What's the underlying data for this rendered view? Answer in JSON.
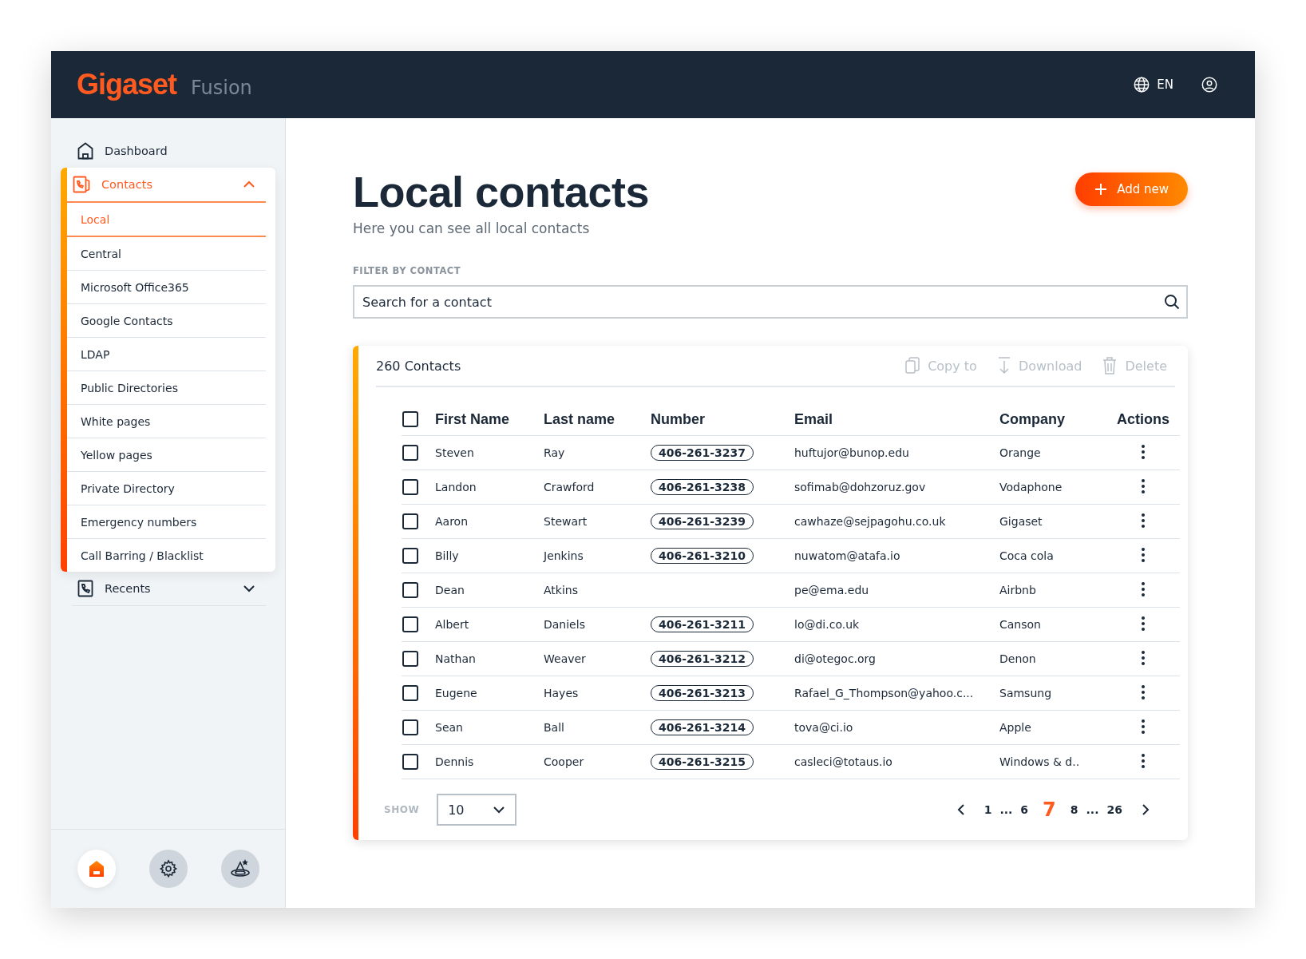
{
  "header": {
    "brand": "Gigaset",
    "product": "Fusion",
    "language": "EN"
  },
  "sidebar": {
    "items": [
      {
        "label": "Dashboard"
      },
      {
        "label": "Contacts",
        "expanded": true,
        "children": [
          {
            "label": "Local",
            "selected": true
          },
          {
            "label": "Central",
            "selected": false
          },
          {
            "label": "Microsoft Office365",
            "selected": false
          },
          {
            "label": "Google Contacts",
            "selected": false
          },
          {
            "label": "LDAP",
            "selected": false
          },
          {
            "label": "Public Directories",
            "selected": false
          },
          {
            "label": "White pages",
            "selected": false
          },
          {
            "label": "Yellow pages",
            "selected": false
          },
          {
            "label": "Private Directory",
            "selected": false
          },
          {
            "label": "Emergency numbers",
            "selected": false
          },
          {
            "label": "Call Barring / Blacklist",
            "selected": false
          }
        ]
      },
      {
        "label": "Recents",
        "expanded": false
      }
    ],
    "bottom_nav": [
      {
        "selected": true
      },
      {
        "selected": false
      },
      {
        "selected": false
      }
    ]
  },
  "page": {
    "title": "Local contacts",
    "subtitle": "Here you can see all local contacts",
    "add_button": "Add new"
  },
  "filter": {
    "label": "FILTER BY CONTACT",
    "placeholder": "Search for a contact"
  },
  "table": {
    "count": "260 Contacts",
    "actions": [
      "Copy to",
      "Download",
      "Delete"
    ],
    "select_all": false,
    "columns": [
      "First Name",
      "Last name",
      "Number",
      "Email",
      "Company",
      "Actions"
    ],
    "rows": [
      {
        "first": "Steven",
        "last": "Ray",
        "number": "406-261-3237",
        "email": "huftujor@bunop.edu",
        "company": "Orange",
        "checked": false
      },
      {
        "first": "Landon",
        "last": "Crawford",
        "number": "406-261-3238",
        "email": "sofimab@dohzoruz.gov",
        "company": "Vodaphone",
        "checked": false
      },
      {
        "first": "Aaron",
        "last": "Stewart",
        "number": "406-261-3239",
        "email": "cawhaze@sejpagohu.co.uk",
        "company": "Gigaset",
        "checked": false
      },
      {
        "first": "Billy",
        "last": "Jenkins",
        "number": "406-261-3210",
        "email": "nuwatom@atafa.io",
        "company": "Coca cola",
        "checked": false
      },
      {
        "first": "Dean",
        "last": "Atkins",
        "email": "pe@ema.edu",
        "company": "Airbnb",
        "checked": false
      },
      {
        "first": "Albert",
        "last": "Daniels",
        "number": "406-261-3211",
        "email": "lo@di.co.uk",
        "company": "Canson",
        "checked": false
      },
      {
        "first": "Nathan",
        "last": "Weaver",
        "number": "406-261-3212",
        "email": "di@otegoc.org",
        "company": "Denon",
        "checked": false
      },
      {
        "first": "Eugene",
        "last": "Hayes",
        "number": "406-261-3213",
        "email": "Rafael_G_Thompson@yahoo.c...",
        "company": "Samsung",
        "checked": false
      },
      {
        "first": "Sean",
        "last": "Ball",
        "number": "406-261-3214",
        "email": "tova@ci.io",
        "company": "Apple",
        "checked": false
      },
      {
        "first": "Dennis",
        "last": "Cooper",
        "number": "406-261-3215",
        "email": "casleci@totaus.io",
        "company": "Windows & d..",
        "checked": false
      }
    ],
    "show_label": "SHOW",
    "page_size": "10",
    "pagination": [
      {
        "label": "1",
        "selected": false
      },
      {
        "label": "...",
        "selected": false
      },
      {
        "label": "6",
        "selected": false
      },
      {
        "label": "7",
        "selected": true
      },
      {
        "label": "8",
        "selected": false
      },
      {
        "label": "...",
        "selected": false
      },
      {
        "label": "26",
        "selected": false
      }
    ]
  }
}
